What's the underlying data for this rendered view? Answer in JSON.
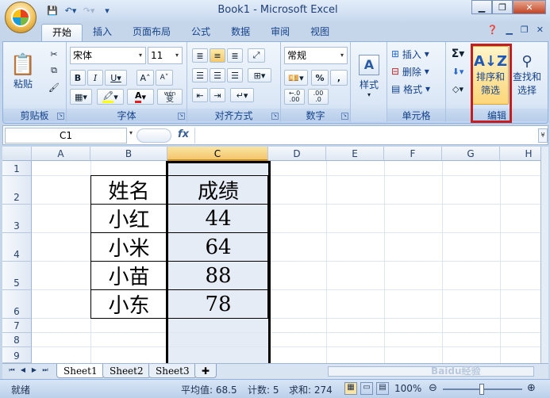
{
  "window": {
    "title": "Book1 - Microsoft Excel"
  },
  "tabs": [
    {
      "label": "开始",
      "active": true
    },
    {
      "label": "插入",
      "active": false
    },
    {
      "label": "页面布局",
      "active": false
    },
    {
      "label": "公式",
      "active": false
    },
    {
      "label": "数据",
      "active": false
    },
    {
      "label": "审阅",
      "active": false
    },
    {
      "label": "视图",
      "active": false
    }
  ],
  "ribbon": {
    "clipboard": {
      "group": "剪贴板",
      "paste": "粘贴"
    },
    "font": {
      "group": "字体",
      "name": "宋体",
      "size": "11",
      "wen": "wén",
      "wen_char": "变"
    },
    "alignment": {
      "group": "对齐方式"
    },
    "number": {
      "group": "数字",
      "format": "常规",
      "dec_inc": ".00",
      "dec_dec": ".0"
    },
    "styles": {
      "label": "样式"
    },
    "cells": {
      "group": "单元格",
      "insert": "插入",
      "delete": "删除",
      "format": "格式"
    },
    "editing": {
      "group": "编辑",
      "sort_line1": "排序和",
      "sort_line2": "筛选",
      "find_line1": "查找和",
      "find_line2": "选择"
    }
  },
  "formula_bar": {
    "name_box": "C1",
    "fx": "fx",
    "value": ""
  },
  "columns": [
    "A",
    "B",
    "C",
    "D",
    "E",
    "F",
    "G",
    "H"
  ],
  "rows": [
    "1",
    "2",
    "3",
    "4",
    "5",
    "6",
    "7",
    "8",
    "9"
  ],
  "cells": {
    "B2": "姓名",
    "C2": "成绩",
    "B3": "小红",
    "C3": "44",
    "B4": "小米",
    "C4": "64",
    "B5": "小苗",
    "C5": "88",
    "B6": "小东",
    "C6": "78"
  },
  "sheets": [
    {
      "label": "Sheet1",
      "active": true
    },
    {
      "label": "Sheet2",
      "active": false
    },
    {
      "label": "Sheet3",
      "active": false
    }
  ],
  "status": {
    "mode": "就绪",
    "average": "平均值: 68.5",
    "count": "计数: 5",
    "sum": "求和: 274",
    "zoom": "100%"
  },
  "watermark": "Baidu经验"
}
